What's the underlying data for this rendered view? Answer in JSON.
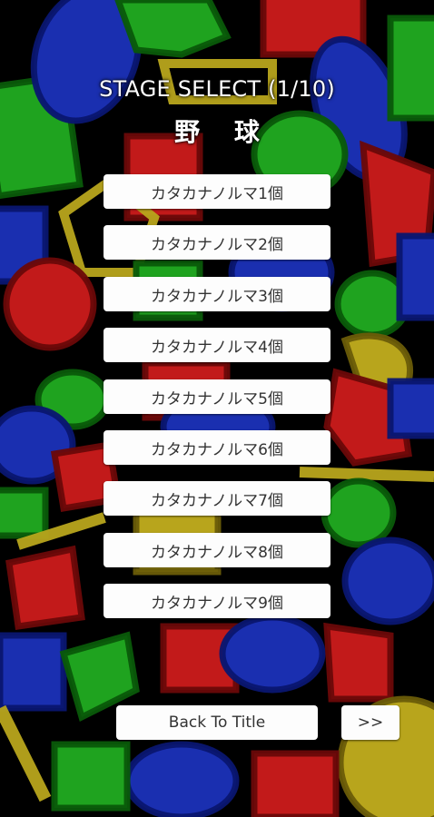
{
  "header": {
    "title": "STAGE SELECT (1/10)",
    "subtitle": "野 球"
  },
  "stages": [
    {
      "label": "カタカナノルマ1個"
    },
    {
      "label": "カタカナノルマ2個"
    },
    {
      "label": "カタカナノルマ3個"
    },
    {
      "label": "カタカナノルマ4個"
    },
    {
      "label": "カタカナノルマ5個"
    },
    {
      "label": "カタカナノルマ6個"
    },
    {
      "label": "カタカナノルマ7個"
    },
    {
      "label": "カタカナノルマ8個"
    },
    {
      "label": "カタカナノルマ9個"
    }
  ],
  "footer": {
    "back_label": "Back To Title",
    "next_label": ">>"
  },
  "colors": {
    "background": "#000000",
    "red": "#c21a1a",
    "green": "#1fa31f",
    "blue": "#1a2fb0",
    "yellow": "#b8a51c",
    "button": "#fdfdfd",
    "button_text": "#333333"
  }
}
